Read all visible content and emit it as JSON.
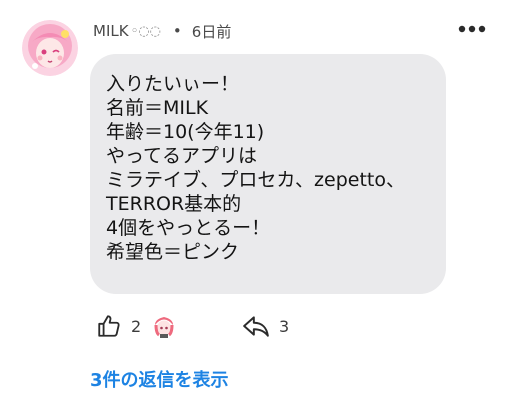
{
  "comment": {
    "author": "MILK",
    "author_decoration": "◦◌◌",
    "separator": "•",
    "time": "6日前",
    "body_lines": [
      "入りたいぃー！",
      "名前＝MILK",
      "年齢＝10(今年11)",
      "やってるアプリは",
      "ミラテイブ、プロセカ、zepetto、",
      "TERROR基本的",
      "4個をやっとるー！",
      "希望色＝ピンク"
    ],
    "like_count": "2",
    "reply_count": "3",
    "view_replies": "3件の返信を表示"
  },
  "icons": {
    "more": "more-horizontal-icon",
    "like": "thumbs-up-icon",
    "reply": "reply-arrow-icon"
  },
  "colors": {
    "bubble": "#eaeaec",
    "link": "#1d83e3",
    "text": "#141414"
  }
}
